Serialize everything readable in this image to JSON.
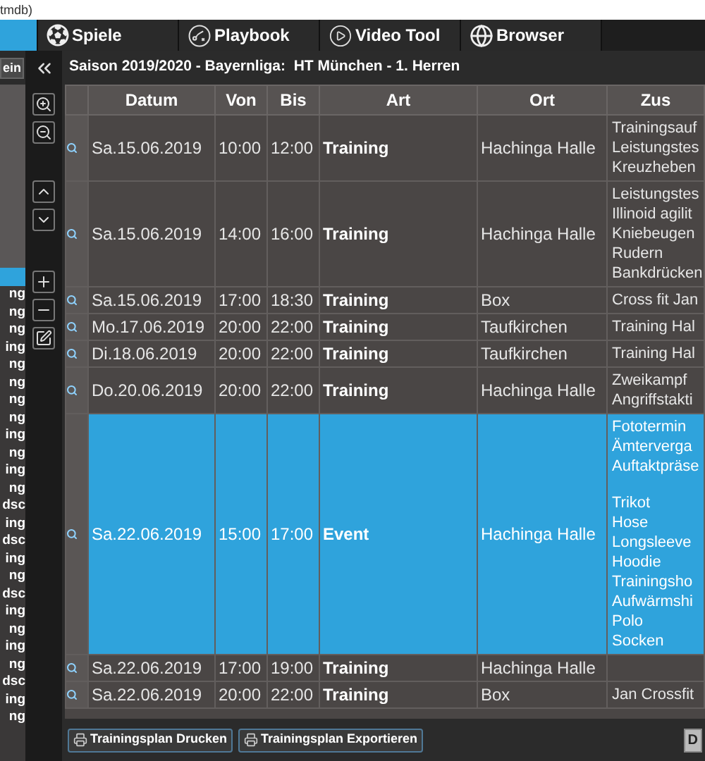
{
  "window": {
    "title": "tmdb)"
  },
  "tabs": [
    {
      "selected": true,
      "kind": "blank"
    },
    {
      "label": "Spiele",
      "selected": false,
      "kind": "ball"
    },
    {
      "label": "Playbook",
      "selected": false,
      "kind": "playbook"
    },
    {
      "label": "Video Tool",
      "selected": false,
      "kind": "video"
    },
    {
      "label": "Browser",
      "selected": false,
      "kind": "globe"
    }
  ],
  "left_button": "ein",
  "sidebar": {
    "items": [
      {
        "selected": true
      },
      {
        "label": "ng",
        "selected": false
      },
      {
        "label": "ng",
        "selected": false
      },
      {
        "label": "ng",
        "selected": false
      },
      {
        "label": "ing",
        "selected": false
      },
      {
        "label": "ng",
        "selected": false
      },
      {
        "label": "ng",
        "selected": false
      },
      {
        "label": "ng",
        "selected": false
      },
      {
        "label": "ng",
        "selected": false
      },
      {
        "label": "ing",
        "selected": false
      },
      {
        "label": "ng",
        "selected": false
      },
      {
        "label": "ing",
        "selected": false
      },
      {
        "label": "ng",
        "selected": false
      },
      {
        "label": "dsc",
        "selected": false
      },
      {
        "label": "ing",
        "selected": false
      },
      {
        "label": "dsc",
        "selected": false
      },
      {
        "label": "ing",
        "selected": false
      },
      {
        "label": "ng",
        "selected": false
      },
      {
        "label": "dsc",
        "selected": false
      },
      {
        "label": "ing",
        "selected": false
      },
      {
        "label": "ng",
        "selected": false
      },
      {
        "label": "ing",
        "selected": false
      },
      {
        "label": "ng",
        "selected": false
      },
      {
        "label": "dsc",
        "selected": false
      },
      {
        "label": "ing",
        "selected": false
      },
      {
        "label": "ng",
        "selected": false
      }
    ]
  },
  "heading": "Saison 2019/2020 - Bayernliga:  HT München - 1. Herren",
  "table": {
    "columns": [
      "Datum",
      "Von",
      "Bis",
      "Art",
      "Ort",
      "Zus"
    ],
    "rows": [
      {
        "date": "Sa.15.06.2019",
        "from": "10:00",
        "to": "12:00",
        "type": "Training",
        "place": "Hachinga Halle",
        "notes": [
          [
            "Trainingsauf",
            "Leistungstes",
            "Kreuzheben"
          ]
        ],
        "selected": false
      },
      {
        "date": "Sa.15.06.2019",
        "from": "14:00",
        "to": "16:00",
        "type": "Training",
        "place": "Hachinga Halle",
        "notes": [
          [
            "Leistungstes",
            "Illinoid agilit",
            "Kniebeugen",
            "Rudern",
            "Bankdrücken"
          ]
        ],
        "selected": false
      },
      {
        "date": "Sa.15.06.2019",
        "from": "17:00",
        "to": "18:30",
        "type": "Training",
        "place": "Box",
        "notes": [
          [
            "Cross fit Jan"
          ]
        ],
        "selected": false
      },
      {
        "date": "Mo.17.06.2019",
        "from": "20:00",
        "to": "22:00",
        "type": "Training",
        "place": "Taufkirchen",
        "notes": [
          [
            "Training Hal"
          ]
        ],
        "selected": false
      },
      {
        "date": "Di.18.06.2019",
        "from": "20:00",
        "to": "22:00",
        "type": "Training",
        "place": "Taufkirchen",
        "notes": [
          [
            "Training Hal"
          ]
        ],
        "selected": false
      },
      {
        "date": "Do.20.06.2019",
        "from": "20:00",
        "to": "22:00",
        "type": "Training",
        "place": "Hachinga Halle",
        "notes": [
          [
            "Zweikampf",
            "Angriffstakti"
          ]
        ],
        "selected": false
      },
      {
        "date": "Sa.22.06.2019",
        "from": "15:00",
        "to": "17:00",
        "type": "Event",
        "place": "Hachinga Halle",
        "notes": [
          [
            "Fototermin",
            "Ämterverga",
            "Auftaktpräse"
          ],
          [
            "Trikot",
            "Hose",
            "Longsleeve",
            "Hoodie",
            "Trainingsho",
            "Aufwärmshi",
            "Polo",
            "Socken"
          ]
        ],
        "selected": true
      },
      {
        "date": "Sa.22.06.2019",
        "from": "17:00",
        "to": "19:00",
        "type": "Training",
        "place": "Hachinga Halle",
        "notes": [],
        "selected": false
      },
      {
        "date": "Sa.22.06.2019",
        "from": "20:00",
        "to": "22:00",
        "type": "Training",
        "place": "Box",
        "notes": [
          [
            "Jan Crossfit"
          ]
        ],
        "selected": false
      }
    ]
  },
  "footer_buttons": [
    {
      "label": "Trainingsplan Drucken",
      "kind": "print"
    },
    {
      "label": "Trainingsplan Exportieren",
      "kind": "print"
    },
    {
      "label": "D",
      "kind": "plain"
    }
  ]
}
